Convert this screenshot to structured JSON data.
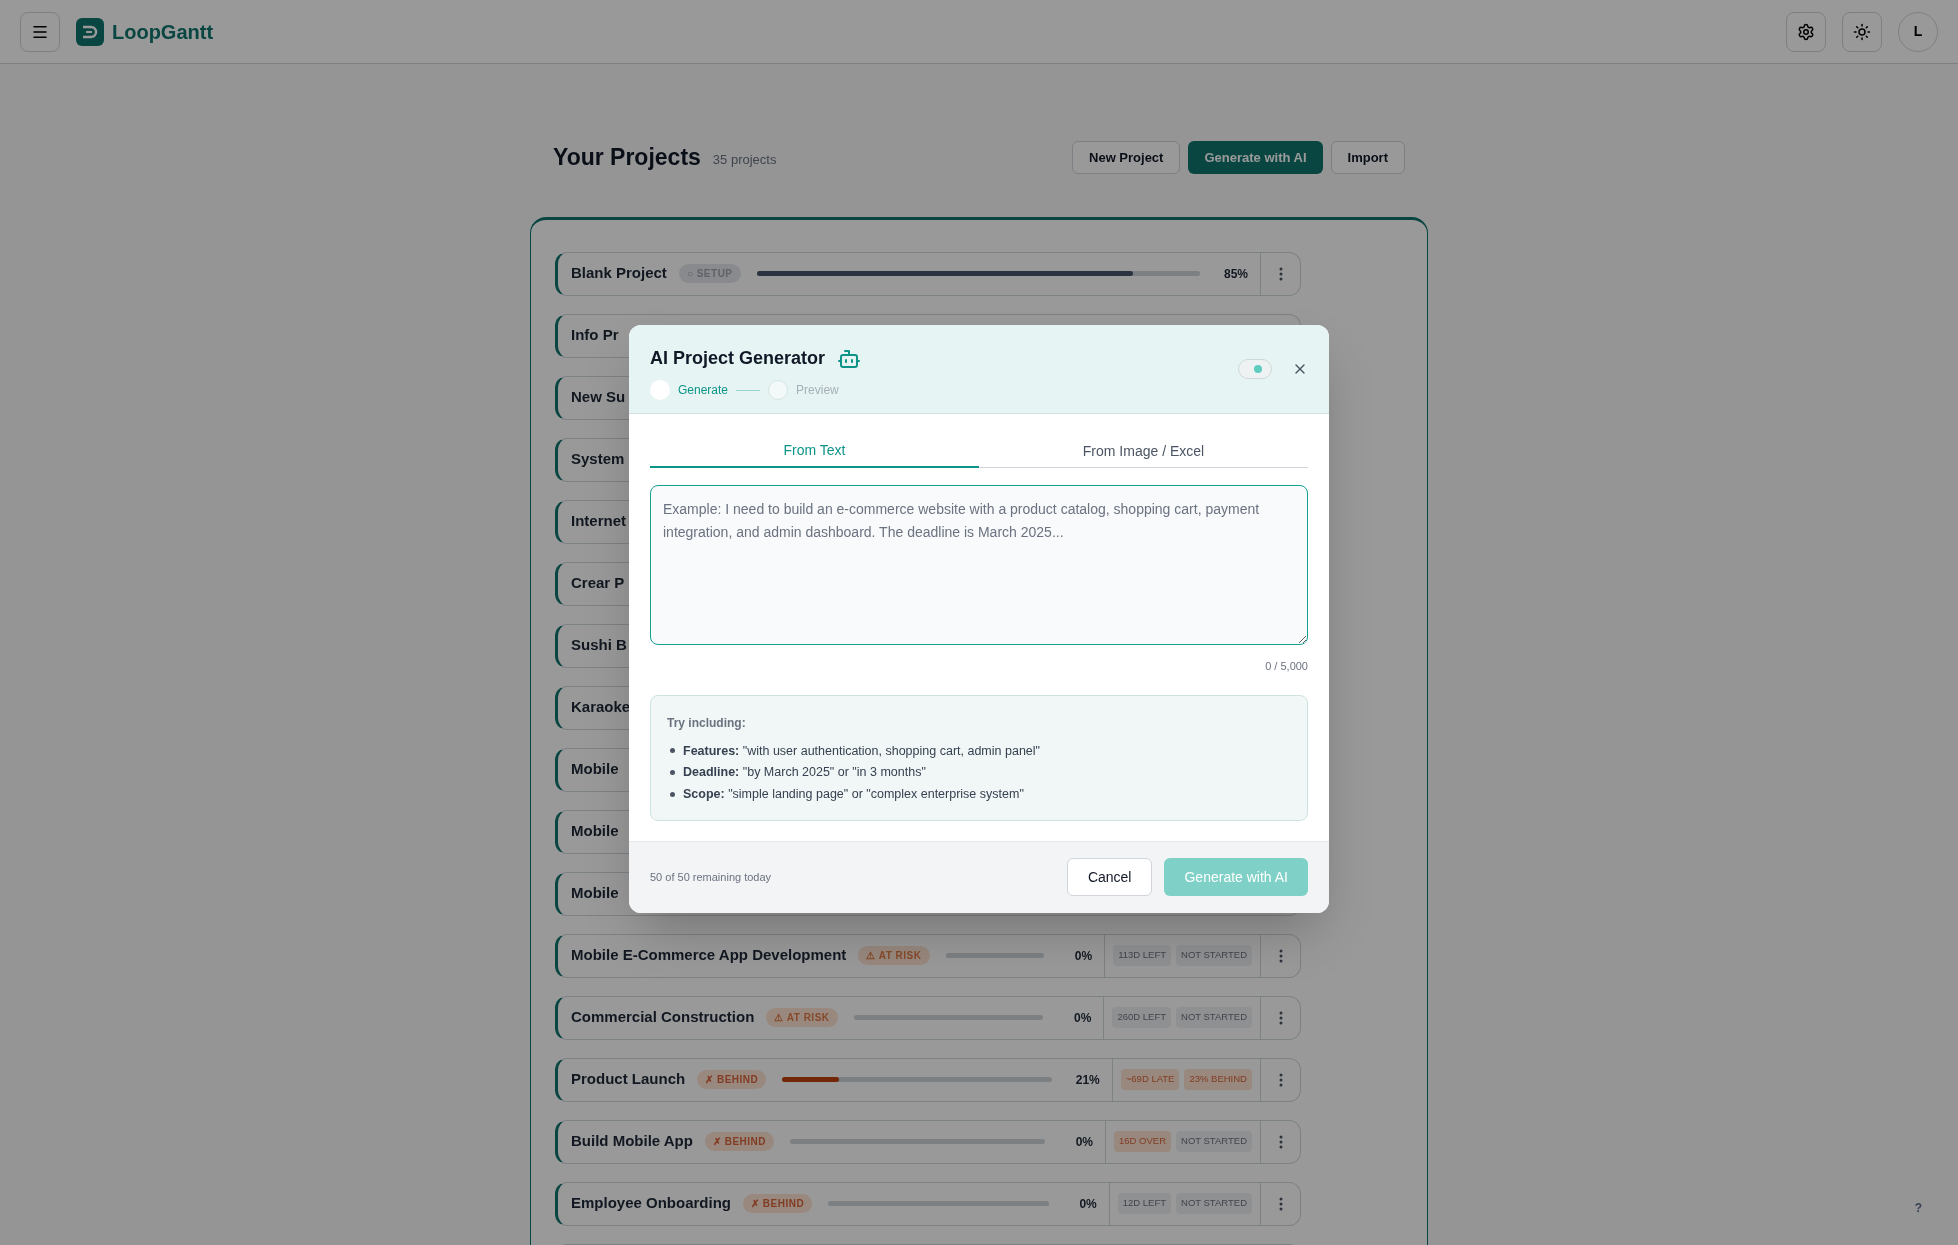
{
  "header": {
    "brand": "LoopGantt",
    "avatar": "L"
  },
  "projects": {
    "title": "Your Projects",
    "count": "35 projects",
    "actions": [
      {
        "label": "New Project",
        "kind": "plain"
      },
      {
        "label": "Generate with AI",
        "kind": "primary"
      },
      {
        "label": "Import",
        "kind": "plain"
      }
    ],
    "rows": [
      {
        "kind": "full",
        "name": "Blank Project",
        "badge": {
          "kind": "setup",
          "text": "○ SETUP"
        },
        "level": 0.85,
        "percent": "85%",
        "tags": []
      },
      {
        "kind": "covered",
        "name": "Info Pr"
      },
      {
        "kind": "covered",
        "name": "New Su"
      },
      {
        "kind": "covered",
        "name": "System"
      },
      {
        "kind": "covered",
        "name": "Internet"
      },
      {
        "kind": "covered",
        "name": "Crear P"
      },
      {
        "kind": "covered",
        "name": "Sushi B"
      },
      {
        "kind": "covered",
        "name": "Karaoke"
      },
      {
        "kind": "covered",
        "name": "Mobile"
      },
      {
        "kind": "covered",
        "name": "Mobile"
      },
      {
        "kind": "covered",
        "name": "Mobile"
      },
      {
        "kind": "full",
        "name": "Mobile E-Commerce App Development",
        "badge": {
          "kind": "risk",
          "text": "⚠ AT RISK"
        },
        "level": 0,
        "percent": "0%",
        "tags": [
          {
            "text": "113D LEFT",
            "kind": "muted"
          },
          {
            "text": "NOT STARTED",
            "kind": "muted"
          }
        ]
      },
      {
        "kind": "full",
        "name": "Commercial Construction",
        "badge": {
          "kind": "risk",
          "text": "⚠ AT RISK"
        },
        "level": 0,
        "percent": "0%",
        "tags": [
          {
            "text": "260D LEFT",
            "kind": "muted"
          },
          {
            "text": "NOT STARTED",
            "kind": "muted"
          }
        ]
      },
      {
        "kind": "full",
        "name": "Product Launch",
        "badge": {
          "kind": "behind",
          "text": "✗ BEHIND"
        },
        "level": 0.21,
        "percent": "21%",
        "tags": [
          {
            "text": "~69D LATE",
            "kind": "alert"
          },
          {
            "text": "23% BEHIND",
            "kind": "alert"
          }
        ]
      },
      {
        "kind": "full",
        "name": "Build Mobile App",
        "badge": {
          "kind": "behind",
          "text": "✗ BEHIND"
        },
        "level": 0,
        "percent": "0%",
        "tags": [
          {
            "text": "16D OVER",
            "kind": "alert"
          },
          {
            "text": "NOT STARTED",
            "kind": "muted"
          }
        ]
      },
      {
        "kind": "full",
        "name": "Employee Onboarding",
        "badge": {
          "kind": "behind",
          "text": "✗ BEHIND"
        },
        "level": 0,
        "percent": "0%",
        "tags": [
          {
            "text": "12D LEFT",
            "kind": "muted"
          },
          {
            "text": "NOT STARTED",
            "kind": "muted"
          }
        ]
      },
      {
        "kind": "empty"
      }
    ]
  },
  "modal": {
    "title": "AI Project Generator",
    "steps": [
      {
        "label": "Generate",
        "selected": true
      },
      {
        "label": "Preview",
        "selected": false
      }
    ],
    "toggle": {
      "on": true
    },
    "tabs": [
      {
        "label": "From Text",
        "selected": true
      },
      {
        "label": "From Image / Excel",
        "selected": false
      }
    ],
    "textarea": {
      "placeholder": "Example: I need to build an e-commerce website with a product catalog, shopping cart, payment integration, and admin dashboard. The deadline is March 2025..."
    },
    "counter": "0 / 5,000",
    "tips": {
      "heading": "Try including:",
      "items": [
        "**Features:** \"with user authentication, shopping cart, admin panel\"",
        "**Deadline:** \"by March 2025\" or \"in 3 months\"",
        "**Scope:** \"simple landing page\" or \"complex enterprise system\""
      ]
    },
    "quota": "50 of 50 remaining today",
    "cancel": "Cancel",
    "submit": {
      "label": "Generate with AI",
      "disabled": true
    }
  },
  "help": "?"
}
